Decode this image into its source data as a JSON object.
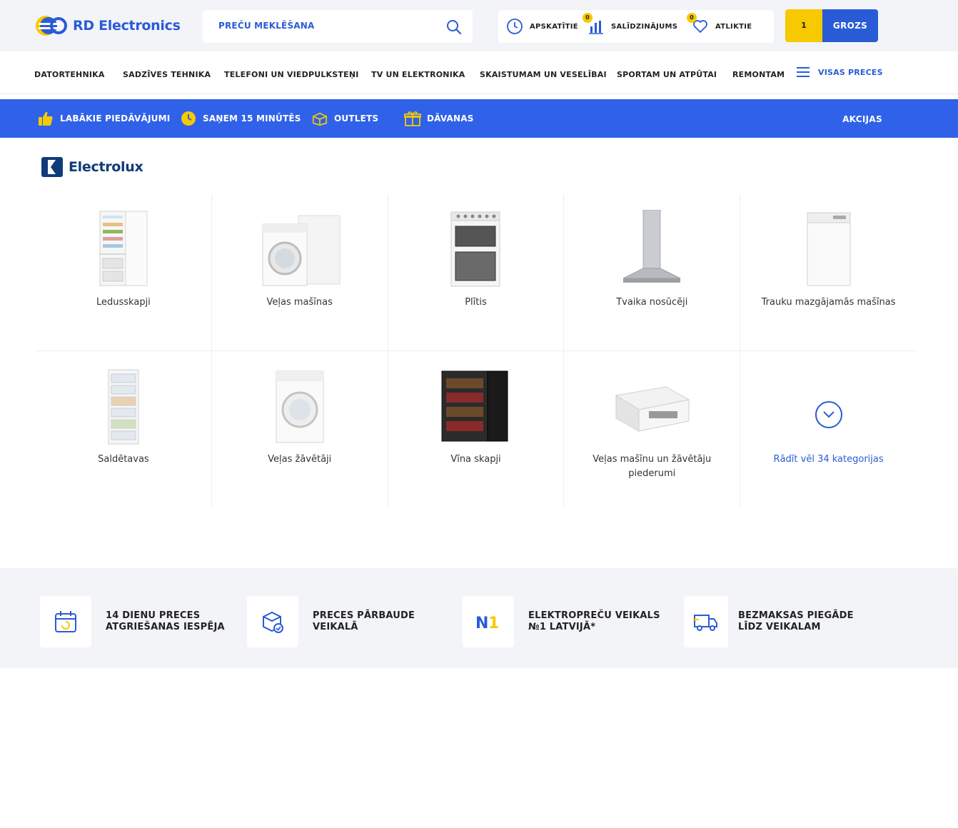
{
  "header": {
    "logo_text": "RD Electronics",
    "search_placeholder": "PREČU MEKLĒŠANA",
    "viewed_label": "APSKATĪTIE",
    "compare_label": "SALĪDZINĀJUMS",
    "compare_count": "0",
    "favorites_label": "ATLIKTIE",
    "favorites_count": "0",
    "cart_count": "1",
    "cart_label": "GROZS"
  },
  "nav": {
    "items": [
      "DATORTEHNIKA",
      "SADZĪVES TEHNIKA",
      "TELEFONI UN VIEDPULKSTEŅI",
      "TV UN ELEKTRONIKA",
      "SKAISTUMAM UN VESELĪBAI",
      "SPORTAM UN ATPŪTAI",
      "REMONTAM"
    ],
    "all_label": "VISAS PRECES"
  },
  "promo": {
    "items": [
      "LABĀKIE PIEDĀVĀJUMI",
      "SAŅEM 15 MINŪTĒS",
      "OUTLETS",
      "DĀVANAS"
    ],
    "akcijas": "AKCIJAS"
  },
  "brand": {
    "name": "Electrolux"
  },
  "categories": [
    {
      "label": "Ledusskapji",
      "icon": "fridge"
    },
    {
      "label": "Veļas mašīnas",
      "icon": "washing-machine"
    },
    {
      "label": "Plītis",
      "icon": "stove"
    },
    {
      "label": "Tvaika nosūcēji",
      "icon": "cooker-hood"
    },
    {
      "label": "Trauku mazgājamās mašīnas",
      "icon": "dishwasher"
    },
    {
      "label": "Saldētavas",
      "icon": "freezer"
    },
    {
      "label": "Veļas žāvētāji",
      "icon": "dryer"
    },
    {
      "label": "Vīna skapji",
      "icon": "wine-cabinet"
    },
    {
      "label": "Veļas mašīnu un žāvētāju piederumi",
      "icon": "pedestal-drawer"
    }
  ],
  "more_categories": "Rādīt vēl 34 kategorijas",
  "benefits": [
    {
      "text": "14 DIENU PRECES ATGRIEŠANAS IESPĒJA",
      "icon": "calendar-return"
    },
    {
      "text": "PRECES PĀRBAUDE VEIKALĀ",
      "icon": "box-check"
    },
    {
      "text": "ELEKTROPREČU VEIKALS №1 LATVIJĀ*",
      "icon": "number-one"
    },
    {
      "text": "BEZMAKSAS PIEGĀDE LĪDZ VEIKALAM",
      "icon": "delivery-truck"
    }
  ],
  "colors": {
    "brand_blue": "#2a5bd7",
    "promo_blue": "#2f62e8",
    "accent_yellow": "#f7c900",
    "header_bg": "#f3f4f8"
  }
}
